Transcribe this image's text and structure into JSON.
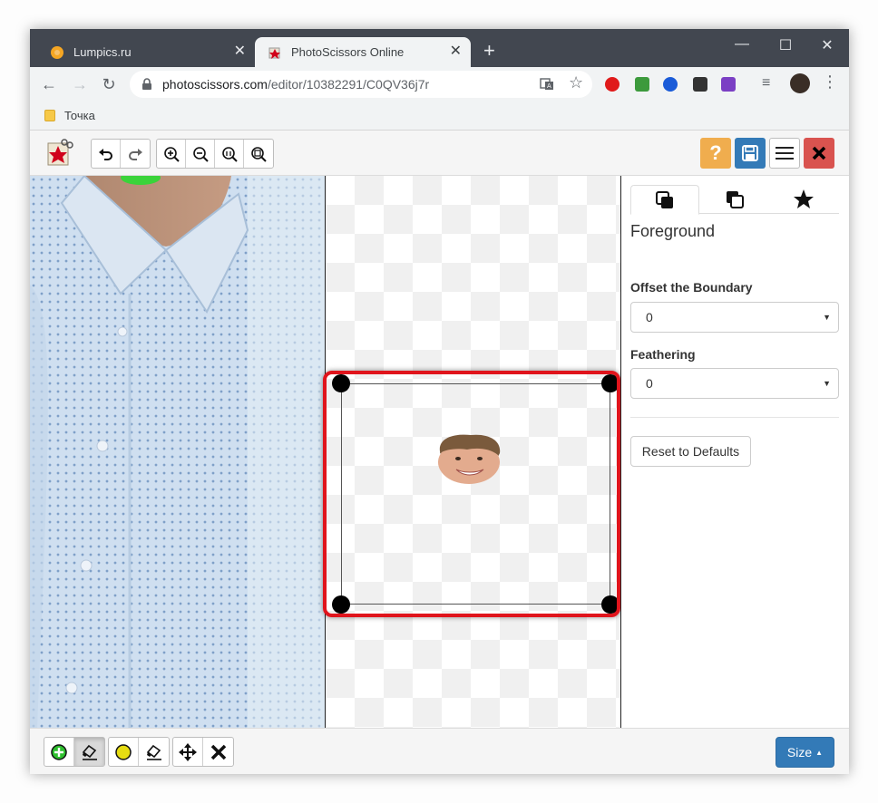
{
  "browser": {
    "tabs": [
      {
        "title": "Lumpics.ru",
        "active": false,
        "favicon": "orange-circle-icon"
      },
      {
        "title": "PhotoScissors Online",
        "active": true,
        "favicon": "photoscissors-icon"
      }
    ],
    "new_tab_symbol": "+",
    "window_controls": {
      "minimize": "—",
      "maximize": "☐",
      "close": "✕"
    },
    "address": {
      "host": "photoscissors.com",
      "path": "/editor/10382291/C0QV36j7r"
    },
    "bookmarks": [
      {
        "label": "Точка",
        "icon": "folder-icon"
      }
    ]
  },
  "editor": {
    "toolbar": {
      "history": [
        "undo-icon",
        "redo-icon"
      ],
      "zoom": [
        "zoom-in-icon",
        "zoom-out-icon",
        "zoom-actual-icon",
        "zoom-fit-icon"
      ],
      "help_symbol": "?",
      "colors": {
        "help": "#f0ad4e",
        "save": "#337ab7",
        "close": "#d9534f"
      }
    },
    "panel": {
      "tabs": [
        "foreground-tab-icon",
        "background-tab-icon",
        "star-icon"
      ],
      "heading": "Foreground",
      "offset_label": "Offset the Boundary",
      "offset_value": "0",
      "feathering_label": "Feathering",
      "feathering_value": "0",
      "reset_label": "Reset to Defaults"
    },
    "bottom_tools": [
      "foreground-marker-icon",
      "eraser-icon",
      "background-marker-icon",
      "eraser-icon",
      "move-icon",
      "clear-icon"
    ],
    "size_label": "Size",
    "highlight_color": "#e0141c"
  }
}
